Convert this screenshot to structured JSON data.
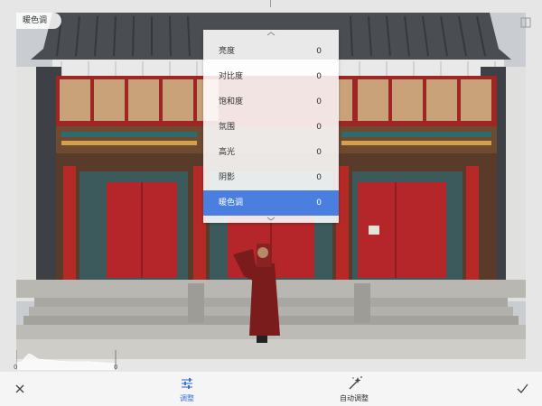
{
  "header": {
    "filter_name": "暖色调"
  },
  "adjust_menu": {
    "items": [
      {
        "label": "亮度",
        "value": "0"
      },
      {
        "label": "对比度",
        "value": "0"
      },
      {
        "label": "饱和度",
        "value": "0"
      },
      {
        "label": "氛围",
        "value": "0"
      },
      {
        "label": "高光",
        "value": "0"
      },
      {
        "label": "阴影",
        "value": "0"
      },
      {
        "label": "暖色调",
        "value": "0"
      }
    ],
    "selected_index": 6
  },
  "histogram": {
    "left_value": "0",
    "right_value": "0"
  },
  "toolbar": {
    "cancel_icon": "close-icon",
    "adjust_label": "调整",
    "adjust_icon": "sliders-icon",
    "auto_label": "自动调整",
    "auto_icon": "magic-wand-icon",
    "apply_icon": "check-icon"
  },
  "colors": {
    "accent": "#4a7fe0",
    "door_red": "#b5262a",
    "robe": "#7a1c1c"
  }
}
